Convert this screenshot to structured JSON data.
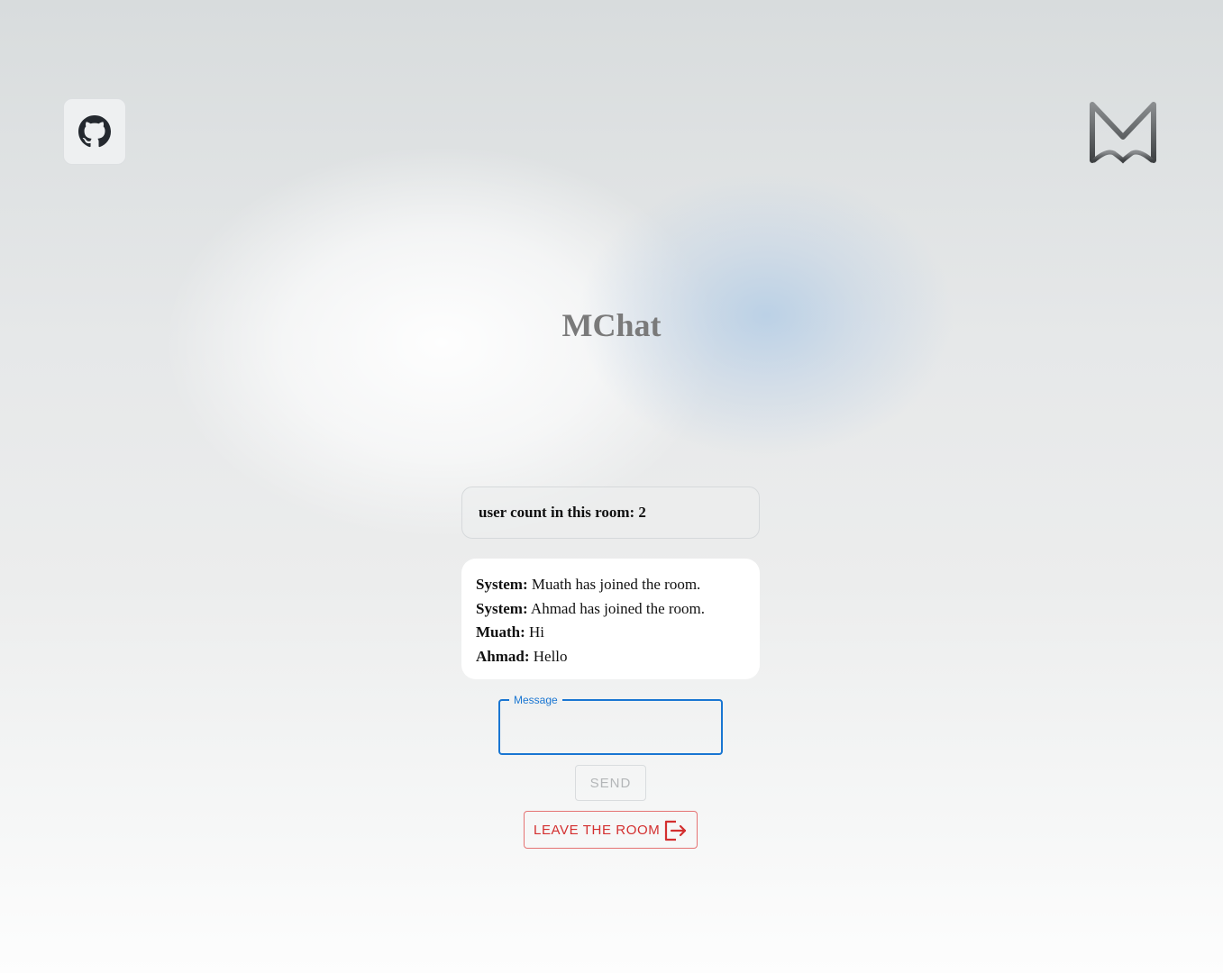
{
  "app": {
    "title": "MChat"
  },
  "header": {
    "github_icon": "github-icon",
    "logo_icon": "mchat-logo-icon"
  },
  "room": {
    "user_count_text": "user count in this room: 2"
  },
  "messages": [
    {
      "author": "System:",
      "text": " Muath has joined the room."
    },
    {
      "author": "System:",
      "text": " Ahmad has joined the room."
    },
    {
      "author": "Muath:",
      "text": " Hi"
    },
    {
      "author": "Ahmad:",
      "text": " Hello"
    }
  ],
  "composer": {
    "label": "Message",
    "value": "",
    "send_label": "SEND",
    "leave_label": "LEAVE THE ROOM",
    "leave_icon": "logout-icon"
  },
  "colors": {
    "accent": "#1976d2",
    "danger": "#d32f2f",
    "title": "#7a7a7a"
  }
}
